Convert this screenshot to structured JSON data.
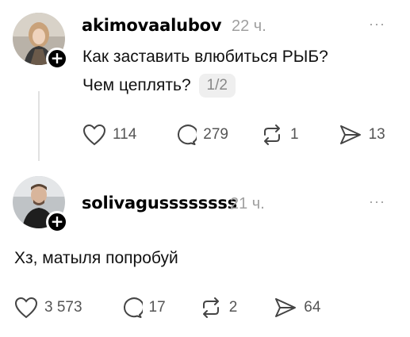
{
  "posts": [
    {
      "username": "akimovaalubov",
      "time": "22 ч.",
      "text_line1": "Как заставить влюбиться РЫБ?",
      "text_line2": "Чем цеплять?",
      "pager": "1/2",
      "likes": "114",
      "comments": "279",
      "reposts": "1",
      "shares": "13"
    },
    {
      "username": "solivagussssssss",
      "time": "21 ч.",
      "text": "Хз, матыля попробуй",
      "likes": "3 573",
      "comments": "17",
      "reposts": "2",
      "shares": "64"
    }
  ],
  "more_label": "···",
  "plus_label": "+",
  "colors": {
    "muted": "#a0a0a0",
    "icon": "#444444",
    "thread_line": "#e1e1e1"
  }
}
